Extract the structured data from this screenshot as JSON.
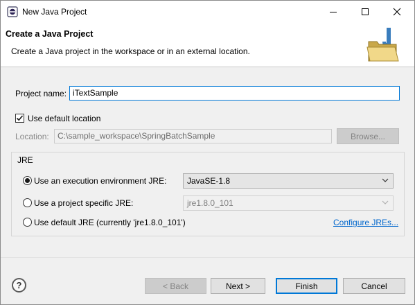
{
  "window": {
    "title": "New Java Project"
  },
  "header": {
    "title": "Create a Java Project",
    "description": "Create a Java project in the workspace or in an external location."
  },
  "project": {
    "name_label": "Project name:",
    "name_value": "iTextSample"
  },
  "location": {
    "default_checkbox_label": "Use default location",
    "default_checked": true,
    "label": "Location:",
    "value": "C:\\sample_workspace\\SpringBatchSample",
    "browse_label": "Browse..."
  },
  "jre": {
    "group_label": "JRE",
    "option_env": {
      "label": "Use an execution environment JRE:",
      "selected": true,
      "value": "JavaSE-1.8"
    },
    "option_specific": {
      "label": "Use a project specific JRE:",
      "selected": false,
      "value": "jre1.8.0_101"
    },
    "option_default": {
      "label": "Use default JRE (currently 'jre1.8.0_101')",
      "selected": false
    },
    "configure_link": "Configure JREs..."
  },
  "footer": {
    "help_glyph": "?",
    "back_label": "< Back",
    "next_label": "Next >",
    "finish_label": "Finish",
    "cancel_label": "Cancel"
  },
  "colors": {
    "accent": "#0078d7",
    "link": "#0066cc"
  }
}
